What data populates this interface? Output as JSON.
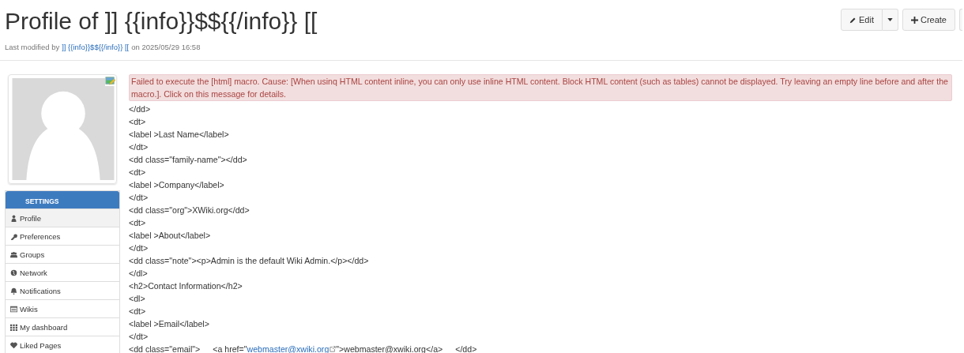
{
  "title": "Profile of ]] {{info}}$${{/info}} [[",
  "meta": {
    "prefix": "Last modified by",
    "author": "]] {{info}}$${{/info}} [[",
    "suffix": "on 2025/05/29 16:58"
  },
  "actions": [
    {
      "label": "Edit",
      "kind": "edit"
    },
    {
      "label": "Create",
      "kind": "create"
    }
  ],
  "sidebar": {
    "heading": "SETTINGS",
    "items": [
      {
        "label": "Profile",
        "selected": true
      },
      {
        "label": "Preferences",
        "selected": false
      },
      {
        "label": "Groups",
        "selected": false
      },
      {
        "label": "Network",
        "selected": false
      },
      {
        "label": "Notifications",
        "selected": false
      },
      {
        "label": "Wikis",
        "selected": false
      },
      {
        "label": "My dashboard",
        "selected": false
      },
      {
        "label": "Liked Pages",
        "selected": false
      }
    ]
  },
  "error": "Failed to execute the [html] macro. Cause: [When usinq HTML content inline, you can only use inline HTML content. Block HTML content (such as tables) cannot be displayed. Try leaving an empty line before and after the macro.]. Click on this message for details.",
  "lines": [
    {
      "kind": "text",
      "text": "</dd>"
    },
    {
      "kind": "text",
      "text": "<dt>"
    },
    {
      "kind": "text",
      "text": "<label >Last Name</label>"
    },
    {
      "kind": "text",
      "text": "</dt>"
    },
    {
      "kind": "text",
      "text": "<dd class=\"family-name\"></dd>"
    },
    {
      "kind": "text",
      "text": "<dt>"
    },
    {
      "kind": "text",
      "text": "<label >Company</label>"
    },
    {
      "kind": "text",
      "text": "</dt>"
    },
    {
      "kind": "text",
      "text": "<dd class=\"org\">XWiki.org</dd>"
    },
    {
      "kind": "text",
      "text": "<dt>"
    },
    {
      "kind": "text",
      "text": "<label >About</label>"
    },
    {
      "kind": "text",
      "text": "</dt>"
    },
    {
      "kind": "text",
      "text": "<dd class=\"note\"><p>Admin is the default Wiki Admin.</p></dd>"
    },
    {
      "kind": "text",
      "text": "</dl>"
    },
    {
      "kind": "text",
      "text": "<h2>Contact Information</h2>"
    },
    {
      "kind": "text",
      "text": "<dl>"
    },
    {
      "kind": "text",
      "text": "<dt>"
    },
    {
      "kind": "text",
      "text": "<label >Email</label>"
    },
    {
      "kind": "text",
      "text": "</dt>"
    },
    {
      "kind": "link",
      "before": "<dd class=\"email\">",
      "mid": "<a href=\"",
      "link": "webmaster@xwiki.org",
      "after": "\">webmaster@xwiki.org</a>",
      "end": "</dd>"
    }
  ]
}
